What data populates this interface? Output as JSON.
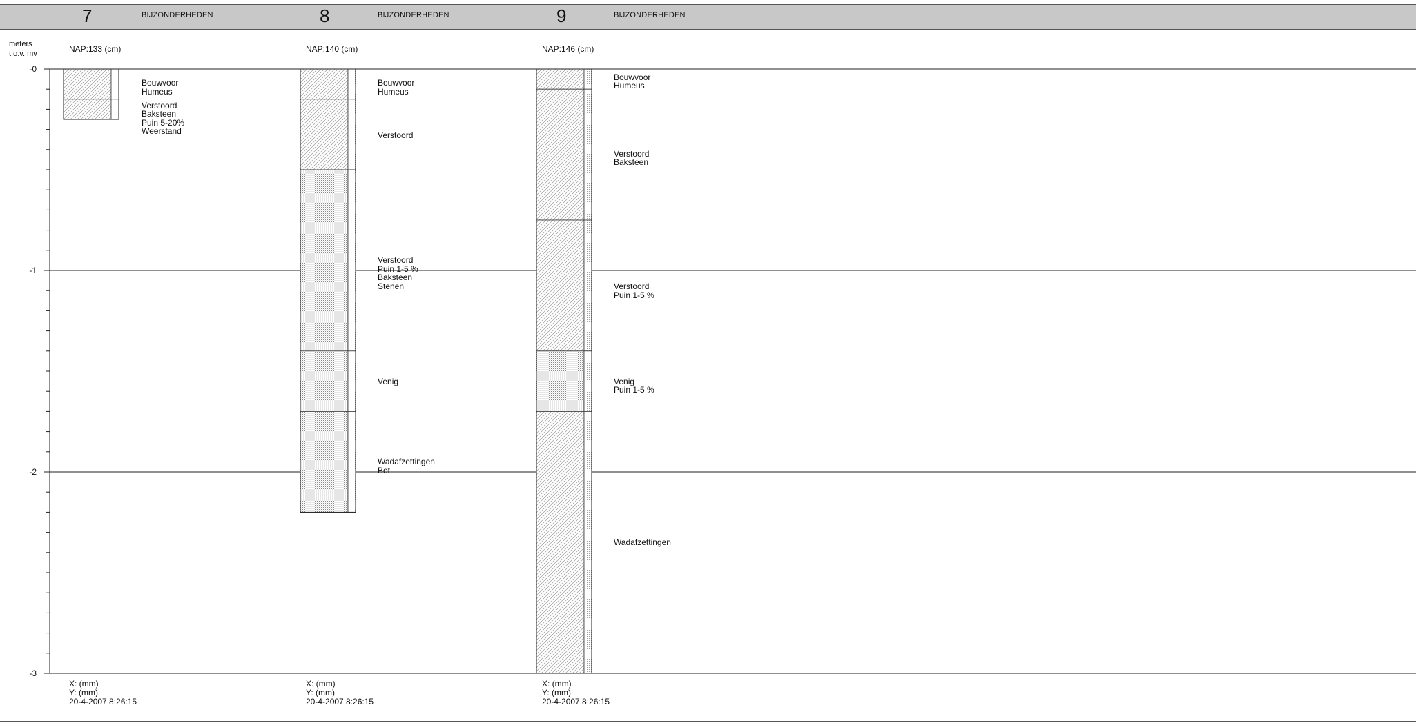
{
  "axis": {
    "unit_line1": "meters",
    "unit_line2": "t.o.v. mv",
    "ticks": [
      {
        "depth": 0,
        "label": "-0"
      },
      {
        "depth": 1,
        "label": "-1"
      },
      {
        "depth": 2,
        "label": "-2"
      },
      {
        "depth": 3,
        "label": "-3"
      }
    ],
    "min_depth": 0,
    "max_depth": 3
  },
  "borings": [
    {
      "number": "7",
      "section_title": "BIJZONDERHEDEN",
      "nap": "NAP:133 (cm)",
      "total_depth": 0.25,
      "layers": [
        {
          "top": 0.0,
          "bottom": 0.15,
          "pattern": "sand",
          "texts": [
            "Bouwvoor",
            "Humeus"
          ],
          "text_depth": 0.07
        },
        {
          "top": 0.15,
          "bottom": 0.25,
          "pattern": "sand",
          "texts": [
            "Verstoord",
            "Baksteen",
            "Puin 5-20%",
            "Weerstand"
          ],
          "text_depth": 0.18
        }
      ],
      "footer": {
        "x": "X:  (mm)",
        "y": "Y:  (mm)",
        "date": "20-4-2007 8:26:15"
      }
    },
    {
      "number": "8",
      "section_title": "BIJZONDERHEDEN",
      "nap": "NAP:140 (cm)",
      "total_depth": 2.2,
      "layers": [
        {
          "top": 0.0,
          "bottom": 0.15,
          "pattern": "sand",
          "texts": [
            "Bouwvoor",
            "Humeus"
          ],
          "text_depth": 0.07
        },
        {
          "top": 0.15,
          "bottom": 0.5,
          "pattern": "sand",
          "texts": [
            "Verstoord"
          ],
          "text_depth": 0.33
        },
        {
          "top": 0.5,
          "bottom": 1.4,
          "pattern": "clay",
          "texts": [
            "Verstoord",
            "Puin 1-5 %",
            "Baksteen",
            "Stenen"
          ],
          "text_depth": 0.95
        },
        {
          "top": 1.4,
          "bottom": 1.7,
          "pattern": "clay",
          "texts": [
            "Venig"
          ],
          "text_depth": 1.55
        },
        {
          "top": 1.7,
          "bottom": 2.2,
          "pattern": "clay",
          "texts": [
            "Wadafzettingen",
            "Bot"
          ],
          "text_depth": 1.95
        }
      ],
      "footer": {
        "x": "X:  (mm)",
        "y": "Y:  (mm)",
        "date": "20-4-2007 8:26:15"
      }
    },
    {
      "number": "9",
      "section_title": "BIJZONDERHEDEN",
      "nap": "NAP:146 (cm)",
      "total_depth": 3.0,
      "layers": [
        {
          "top": 0.0,
          "bottom": 0.1,
          "pattern": "sand",
          "texts": [
            "Bouwvoor",
            "Humeus"
          ],
          "text_depth": 0.04
        },
        {
          "top": 0.1,
          "bottom": 0.75,
          "pattern": "sand",
          "texts": [
            "Verstoord",
            "Baksteen"
          ],
          "text_depth": 0.42
        },
        {
          "top": 0.75,
          "bottom": 1.4,
          "pattern": "sand",
          "texts": [
            "Verstoord",
            "Puin 1-5 %"
          ],
          "text_depth": 1.08
        },
        {
          "top": 1.4,
          "bottom": 1.7,
          "pattern": "clay",
          "texts": [
            "Venig",
            "Puin 1-5 %"
          ],
          "text_depth": 1.55
        },
        {
          "top": 1.7,
          "bottom": 3.0,
          "pattern": "sand",
          "texts": [
            "Wadafzettingen"
          ],
          "text_depth": 2.35
        }
      ],
      "footer": {
        "x": "X:  (mm)",
        "y": "Y:  (mm)",
        "date": "20-4-2007 8:26:15"
      }
    }
  ]
}
